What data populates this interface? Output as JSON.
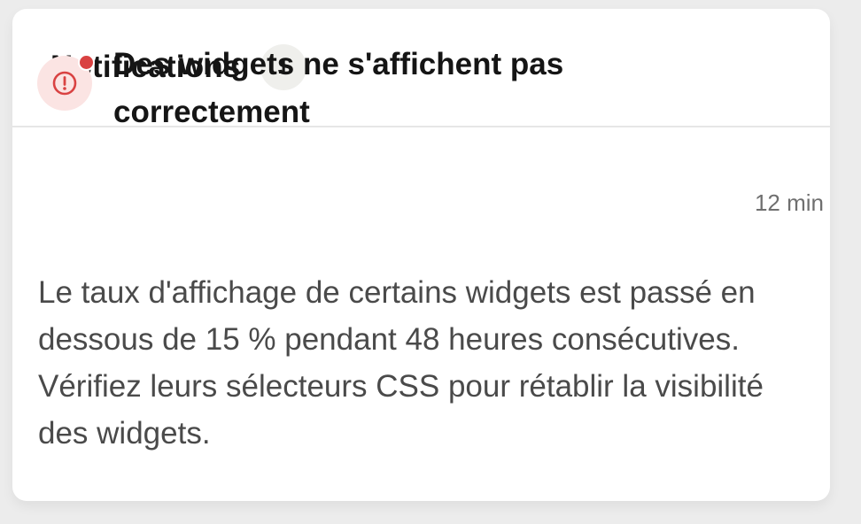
{
  "panel": {
    "title": "Notifications",
    "count": "1"
  },
  "notification": {
    "icon": "alert-circle-icon",
    "unread": true,
    "title": "Des widgets ne s'affichent pas correctement",
    "time": "12 min",
    "body": "Le taux d'affichage de certains widgets est passé en dessous de 15 % pendant 48 heures consécutives. Vérifiez leurs sélecteurs CSS pour rétablir la visibilité des widgets."
  },
  "colors": {
    "alert": "#d94242",
    "alert_bg": "#fbe4e3",
    "badge_bg": "#efefec"
  }
}
